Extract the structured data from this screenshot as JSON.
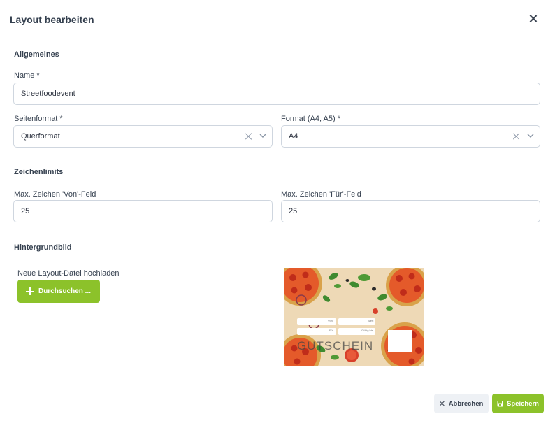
{
  "dialog": {
    "title": "Layout bearbeiten"
  },
  "general": {
    "heading": "Allgemeines",
    "name_label": "Name *",
    "name_value": "Streetfoodevent",
    "page_format_label": "Seitenformat *",
    "page_format_value": "Querformat",
    "format_label": "Format (A4, A5) *",
    "format_value": "A4"
  },
  "char_limits": {
    "heading": "Zeichenlimits",
    "from_label": "Max. Zeichen 'Von'-Feld",
    "from_value": "25",
    "for_label": "Max. Zeichen 'Für'-Feld",
    "for_value": "25"
  },
  "background": {
    "heading": "Hintergrundbild",
    "upload_label": "Neue Layout-Datei hochladen",
    "browse_label": "Durchsuchen ...",
    "preview": {
      "field_von": "Von",
      "field_wert": "Wert",
      "field_fuer": "Für",
      "field_gueltig": "Gültig bis",
      "voucher_text": "GUTSCHEIN"
    }
  },
  "footer": {
    "cancel_label": "Abbrechen",
    "save_label": "Speichern"
  },
  "colors": {
    "accent": "#8cc22a",
    "border": "#cfd6df"
  },
  "icons": [
    "close-icon",
    "clear-icon",
    "chevron-down-icon",
    "plus-icon",
    "save-icon"
  ]
}
